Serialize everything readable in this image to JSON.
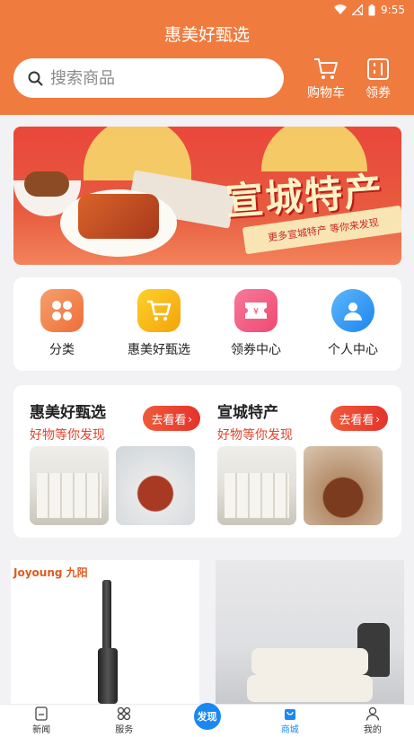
{
  "status_bar": {
    "time": "9:55"
  },
  "header": {
    "title": "惠美好甄选",
    "search_placeholder": "搜索商品",
    "cart_label": "购物车",
    "coupon_label": "领券"
  },
  "banner": {
    "headline": "宣城特产",
    "ribbon_text": "更多宣城特产 等你来发现",
    "slide_count": 2,
    "active_slide": 2
  },
  "categories": [
    {
      "label": "分类",
      "icon": "grid-icon",
      "color": "#f2834a"
    },
    {
      "label": "惠美好甄选",
      "icon": "cart-icon",
      "color": "#f7b50f"
    },
    {
      "label": "领券中心",
      "icon": "coupon-icon",
      "color": "#f2577c"
    },
    {
      "label": "个人中心",
      "icon": "user-icon",
      "color": "#2f9bf5"
    }
  ],
  "promos": [
    {
      "title": "惠美好甄选",
      "subtitle": "好物等你发现",
      "button": "去看看"
    },
    {
      "title": "宣城特产",
      "subtitle": "好物等你发现",
      "button": "去看看"
    }
  ],
  "products": [
    {
      "brand": "Joyoung 九阳"
    },
    {
      "brand": ""
    }
  ],
  "tabbar": [
    {
      "label": "新闻",
      "icon": "news-icon"
    },
    {
      "label": "服务",
      "icon": "services-icon"
    },
    {
      "label": "发现",
      "icon": "discover-icon"
    },
    {
      "label": "商城",
      "icon": "mall-icon",
      "active": true
    },
    {
      "label": "我的",
      "icon": "profile-icon"
    }
  ],
  "colors": {
    "header_orange": "#f07b3f",
    "accent_red": "#e4432d",
    "tab_active_blue": "#1b88f0"
  }
}
